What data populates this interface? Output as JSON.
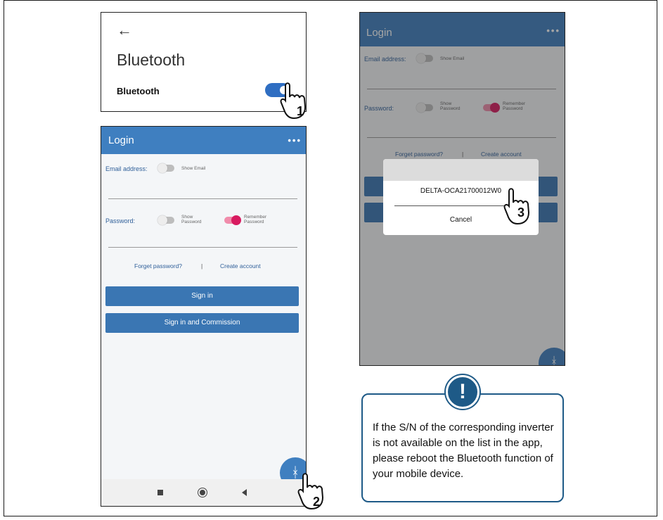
{
  "bluetooth_panel": {
    "back_icon": "←",
    "title": "Bluetooth",
    "row_label": "Bluetooth",
    "toggle_on": true
  },
  "login": {
    "title": "Login",
    "menu_icon": "•••",
    "email_label": "Email address:",
    "show_email": "Show Email",
    "password_label": "Password:",
    "show_password": "Show\nPassword",
    "remember_password": "Remember\nPassword",
    "forget_password": "Forget password?",
    "separator": "|",
    "create_account": "Create account",
    "sign_in": "Sign in",
    "sign_in_commission": "Sign in and Commission",
    "bluetooth_fab_icon": "ᚼ"
  },
  "dialog": {
    "device": "DELTA-OCA21700012W0",
    "cancel": "Cancel"
  },
  "steps": [
    "1",
    "2",
    "3"
  ],
  "note": {
    "icon": "!",
    "text": "If the S/N of the corresponding inverter is not available on the list in the app, please reboot the Bluetooth function of your mobile device."
  },
  "colors": {
    "appbar": "#3f7fc0",
    "button": "#3a76b3",
    "accent_pink": "#d81b60",
    "note_border": "#1e5a87"
  }
}
